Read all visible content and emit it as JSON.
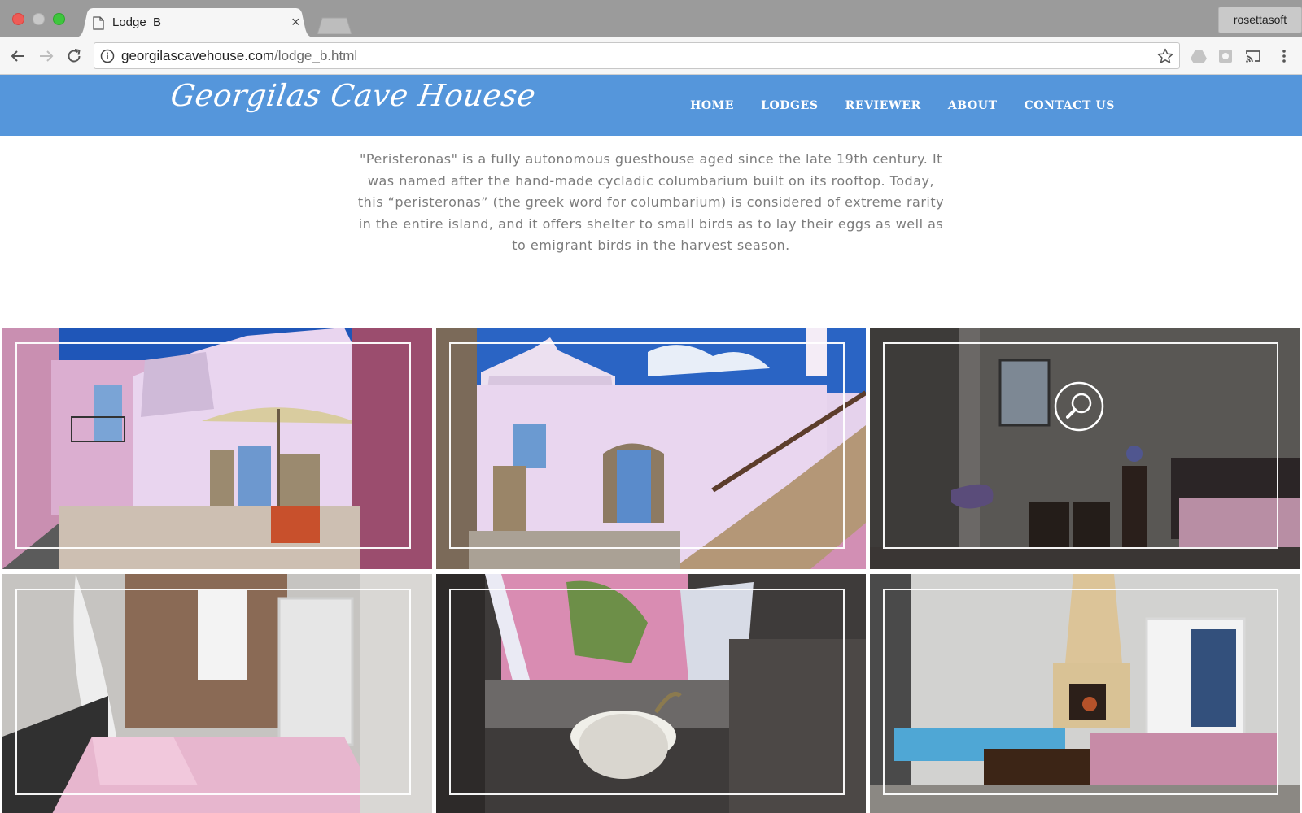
{
  "browser": {
    "tab_title": "Lodge_B",
    "url_domain": "georgilascavehouse.com",
    "url_path": "/lodge_b.html",
    "profile_name": "rosettasoft"
  },
  "site": {
    "logo_text": "Georgilas Cave Houese",
    "brand_color": "#5596db",
    "nav": [
      "HOME",
      "LODGES",
      "REVIEWER",
      "ABOUT",
      "CONTACT US"
    ]
  },
  "intro_lines": [
    "\"Peristeronas\" is a fully autonomous guesthouse aged since the late 19th century. It",
    "was named after the hand-made cycladic columbarium built on its rooftop. Today,",
    "this “peristeronas” (the greek word for columbarium) is considered of extreme rarity",
    "in the entire island, and it offers shelter to small birds as to lay their eggs as well as",
    "to emigrant birds in the harvest season."
  ],
  "gallery": [
    {
      "subject": "courtyard with umbrella",
      "icon": "photo"
    },
    {
      "subject": "columbarium facade with stairs",
      "icon": "photo"
    },
    {
      "subject": "bedroom with mirror",
      "icon": "zoom-icon"
    },
    {
      "subject": "bedroom with canopy bed",
      "icon": "photo"
    },
    {
      "subject": "window with washbasin",
      "icon": "photo"
    },
    {
      "subject": "living room with fireplace",
      "icon": "photo"
    }
  ]
}
